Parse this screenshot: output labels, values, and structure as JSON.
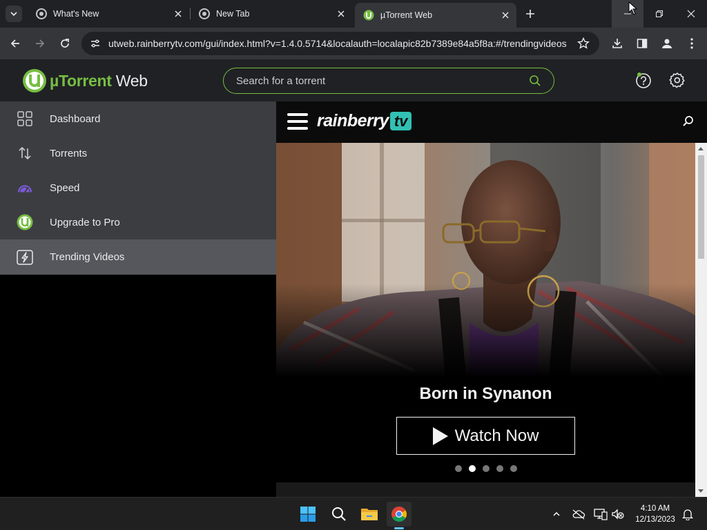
{
  "browser": {
    "tabs": [
      {
        "title": "What's New"
      },
      {
        "title": "New Tab"
      },
      {
        "title": "µTorrent Web",
        "active": true
      }
    ],
    "url": "utweb.rainberrytv.com/gui/index.html?v=1.4.0.5714&localauth=localapic82b7389e84a5f8a:#/trendingvideos"
  },
  "app": {
    "logo_brand": "µTorrent",
    "logo_suffix": "Web",
    "search_placeholder": "Search for a torrent",
    "accent_color": "#76be43"
  },
  "sidebar": {
    "items": [
      {
        "label": "Dashboard",
        "icon": "dashboard-grid-icon"
      },
      {
        "label": "Torrents",
        "icon": "up-down-arrows-icon"
      },
      {
        "label": "Speed",
        "icon": "speedometer-icon"
      },
      {
        "label": "Upgrade to Pro",
        "icon": "utorrent-logo-icon"
      },
      {
        "label": "Trending Videos",
        "icon": "lightning-screen-icon",
        "active": true
      }
    ]
  },
  "rainberry": {
    "logo_word": "rainberry",
    "logo_tv": "tv",
    "tv_color": "#31c1b4",
    "featured_title": "Born in Synanon",
    "watch_label": "Watch Now",
    "slides_count": 5,
    "active_slide": 2
  },
  "taskbar": {
    "time": "4:10 AM",
    "date": "12/13/2023"
  }
}
